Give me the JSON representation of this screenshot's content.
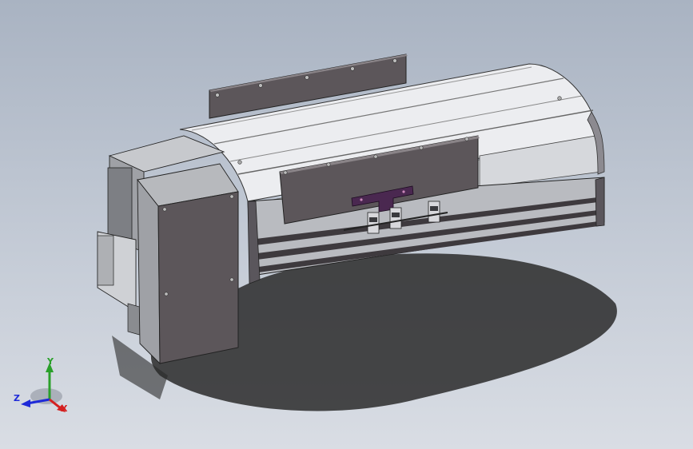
{
  "triad": {
    "labels": [
      {
        "name": "y",
        "text": "Y",
        "color": "#2aa02a"
      },
      {
        "name": "z",
        "text": "Z",
        "color": "#1e2ad8"
      },
      {
        "name": "x",
        "text": "X",
        "color": "#d42020"
      }
    ]
  },
  "colors": {
    "panel_dark": "#5c565a",
    "panel_light": "#ecedf0",
    "rail_dark": "#3e3a3e",
    "accent_plate": "#4a2850",
    "background_top": "#a9b3c2",
    "background_bottom": "#d9dde4"
  }
}
